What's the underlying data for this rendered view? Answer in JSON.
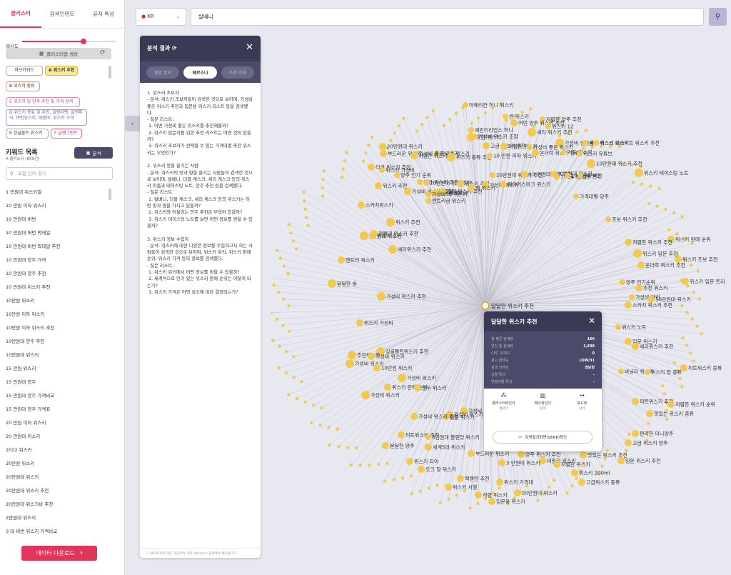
{
  "tabs": [
    "클러스터",
    "검색인텐트",
    "유저 특성"
  ],
  "slider": {
    "label": "해상도",
    "value": 0.65
  },
  "gen_btn": "클러스터맵 생성",
  "chips": [
    "허브키워드",
    "A 위스키 추천",
    "B 위스키 종류",
    "C 위스키 및 양주 추천 및 가격 검색",
    "D 위스키 종류 및 추천, 글렌리벳, 글렌피딕, 버번위스키, 에덴바, 위스키 가격",
    "E 싱글몰트 위스키",
    "F 글렌그란트"
  ],
  "kw": {
    "title": "키워드 목록",
    "sub": "A 클러스터 (659건)",
    "analyze": "분석",
    "placeholder": "포함 단어 찾기",
    "items": [
      "1 만원대 위스키갤",
      "10 만원 이하 위스키",
      "10 만원대 버번",
      "10 만원대 버번 락테일",
      "10 만원대 버번 락테일 추천",
      "10 만원대 양주 가격",
      "10 만원대 양주 추천",
      "10 만원대 위스키 추천",
      "10만원 위스키",
      "10만원 이하 위스키",
      "10만원 이하 위스키 추천",
      "10만원대 양주 추천",
      "10만원대 위스키",
      "15 만원 위스키",
      "15 만원대 양주",
      "15 만원대 양주 가격비교",
      "15 만원대 양주 가격표",
      "20 만원 이하 위스키",
      "20 만원대 위스키",
      "2022 위스키",
      "20만원 위스키",
      "20만원대 위스키",
      "20만원대 위스키 추천",
      "20만원대 위스키바 추천",
      "2만원대 위스키",
      "3 대 버번 위스키 가격비교"
    ]
  },
  "download": "데이터 다운로드",
  "country": "KR",
  "search": "발베니",
  "panel": {
    "title": "분석 결과",
    "tabs": [
      "종합 분석",
      "페르소나",
      "추천 조회"
    ],
    "body": "1. 위스키 초보자\n- 분석: 위스키 초보자들이 검색한 것으로 보이며, 가성비 좋은 위스키 추천과 입문용 위스키 리스트 등을 검색했다.\n- 질문 리스트:\n 1. 어떤 가성비 좋은 위스키를 추천해줄까?\n 2. 위스키 입문자를 위한 추천 리스트는 어떤 것이 있을까?\n 3. 위스키 초보자가 선택할 수 있는 가격대별 추천 위스키는 무엇인가?\n\n2. 위스키 맛을 즐기는 사람\n- 분석: 위스키의 맛과 향을 즐기는 사람들이 검색한 것으로 보이며, 발베니, 더블 캐스크, 셰리 캐스크 등의 위스키 이름과 테이스팅 노트, 안주 추천 등을 검색했다.\n- 질문 리스트:\n 1. 발베니, 더블 캐스크, 셰리 캐스크 등의 위스키는 어떤 맛과 향을 가지고 있을까?\n 2. 위스키와 어울리는 안주 추천은 무엇이 있을까?\n 3. 위스키 테이스팅 노트를 보면 어떤 정보를 얻을 수 있을까?\n\n3. 위스키 정보 수집자\n- 분석: 위스키에 대한 다양한 정보를 수집하고자 하는 사람들이 검색한 것으로 보이며, 위스키 위키, 위스키 판매 순위, 위스키 가격 등의 정보를 검색했다.\n- 질문 리스트:\n 1. 위스키 위키에서 어떤 정보를 얻을 수 있을까?\n 2. 세계적으로 인기 있는 위스키 판매 순위는 어떻게 되는가?\n 3. 위스키 가격은 어떤 요소에 따라 결정되는가?",
    "footer": "ⓘ 66/30자의 해당 가능하며, 이후 Advance 플랜에서 확인합니다."
  },
  "popup": {
    "title": "달달한 위스키 추천",
    "rows": [
      [
        "월 평균 검색량",
        "166"
      ],
      [
        "연간 총 검색량",
        "1,938"
      ],
      [
        "CPC (USD)",
        "0"
      ],
      [
        "광고 경쟁도",
        "LOW/31"
      ],
      [
        "검색 인텐트",
        "정보형"
      ],
      [
        "성별 특성",
        "-"
      ],
      [
        "연령대별 특성",
        "-"
      ]
    ],
    "actions": [
      [
        "클러스터파인더",
        "재탐색"
      ],
      [
        "패스파인더",
        "탐색"
      ],
      [
        "로드뷰",
        "탐색"
      ]
    ],
    "serp": "검색결과화면(SERP)확인"
  },
  "graph": {
    "center": "달달한 위스키 추천",
    "nodes": [
      [
        "아메리칸 허니 위스키",
        652,
        147,
        4
      ],
      [
        "저렴한 양주 추천",
        760,
        167,
        4
      ],
      [
        "어떤 양주 위스키 추천",
        720,
        172,
        5
      ],
      [
        "위스키 12",
        768,
        177,
        4
      ],
      [
        "싼 위스키",
        708,
        163,
        4
      ],
      [
        "예반리리엄스 허니",
        660,
        182,
        4
      ],
      [
        "셰리 위스키 추천",
        745,
        185,
        6
      ],
      [
        "핫한 위스키",
        660,
        192,
        6
      ],
      [
        "가성비 위스키 조합",
        665,
        191,
        4
      ],
      [
        "가성비 싱글몰트",
        784,
        200,
        6
      ],
      [
        "셰리 캐스크 위스키",
        820,
        200,
        4
      ],
      [
        "고급 위스키 추천",
        681,
        204,
        5
      ],
      [
        "저렴한 위스키",
        706,
        205,
        5
      ],
      [
        "가성비 좋은 위스키",
        742,
        206,
        4
      ],
      [
        "위스키 브라이트 위스키 추천",
        835,
        200,
        4
      ],
      [
        "20만원대 위스키",
        536,
        205,
        5
      ],
      [
        "부드러운 위스키",
        537,
        215,
        5
      ],
      [
        "유니콘 위스키",
        612,
        215,
        4
      ],
      [
        "가성비 좋은 위스키",
        582,
        215,
        4
      ],
      [
        "저렴한 위스키",
        580,
        218,
        5
      ],
      [
        "위스키 종류 추천",
        632,
        220,
        6
      ],
      [
        "10 만원 이하 위스키",
        686,
        218,
        4
      ],
      [
        "온더락 위스키 종류",
        750,
        214,
        5
      ],
      [
        "저도 위스키",
        790,
        213,
        4
      ],
      [
        "위스키 유튜브",
        812,
        215,
        4
      ],
      [
        "10만원대 위스키 추천",
        828,
        229,
        6
      ],
      [
        "리카 위스키 추천",
        520,
        234,
        5
      ],
      [
        "위스키 가성비",
        535,
        238,
        4
      ],
      [
        "양주 인기 순위",
        556,
        245,
        4
      ],
      [
        "20만원대 위스키 추천",
        690,
        245,
        4
      ],
      [
        "10 만원대 양주 추천",
        735,
        244,
        5
      ],
      [
        "20만원대 위스키",
        775,
        243,
        4
      ],
      [
        "7~24 캐스크",
        780,
        248,
        4
      ],
      [
        "10만원대 버번",
        795,
        246,
        4
      ],
      [
        "24 빌즈",
        813,
        246,
        4
      ],
      [
        "위스키 테이스팅 노트",
        895,
        242,
        6
      ],
      [
        "저가 위스키 추천",
        588,
        255,
        4
      ],
      [
        "20만원대 양주 추천",
        597,
        256,
        4
      ],
      [
        "위스키 추천",
        645,
        257,
        5
      ],
      [
        "가성비 위스키",
        680,
        259,
        5
      ],
      [
        "위스키 추천",
        530,
        260,
        5
      ],
      [
        "가성비 비 양주 추천",
        571,
        268,
        5
      ],
      [
        "양주 가격표",
        608,
        270,
        4
      ],
      [
        "가성비 위스키",
        610,
        270,
        5
      ],
      [
        "로얄 위스키 추천",
        620,
        268,
        5
      ],
      [
        "가성비 비 위스키",
        600,
        272,
        4
      ],
      [
        "벨 위스키",
        660,
        263,
        5
      ],
      [
        "메이커스마크 위스키",
        705,
        258,
        5
      ],
      [
        "엔트리급 위스키",
        600,
        281,
        4
      ],
      [
        "가격대별 양주",
        807,
        275,
        4
      ],
      [
        "스카치위스키",
        506,
        287,
        5
      ],
      [
        "위스키 추천",
        547,
        311,
        6
      ],
      [
        "초보 위스키 추천",
        852,
        307,
        4
      ],
      [
        "2만원대 위스키",
        510,
        330,
        6
      ],
      [
        "위스키 추천",
        522,
        330,
        5
      ],
      [
        "정몰대 위스키 추천",
        524,
        327,
        5
      ],
      [
        "위스키 판매 순위",
        940,
        335,
        5
      ],
      [
        "저렴한 위스키 추천",
        880,
        339,
        5
      ],
      [
        "셰리위스키 추천",
        550,
        349,
        6
      ],
      [
        "위스키 입문 추천",
        893,
        355,
        6
      ],
      [
        "위스키 초보 추천",
        950,
        363,
        5
      ],
      [
        "엔트리 위스키",
        478,
        364,
        5
      ],
      [
        "온더락 위스키 추천",
        898,
        371,
        5
      ],
      [
        "양주 인기순위",
        872,
        395,
        4
      ],
      [
        "위스키 입문 트리",
        960,
        394,
        5
      ],
      [
        "달달한 술",
        465,
        397,
        6
      ],
      [
        "추천 위스키",
        895,
        403,
        5
      ],
      [
        "가성비 위스키 추천",
        534,
        415,
        6
      ],
      [
        "가성비 버번",
        885,
        416,
        4
      ],
      [
        "10만원대 위스키",
        912,
        419,
        5
      ],
      [
        "스카치 위스키 추천",
        880,
        427,
        5
      ],
      [
        "위스키 가성비",
        504,
        452,
        5
      ],
      [
        "위스키 노트",
        866,
        458,
        4
      ],
      [
        "싱글몰트위스키 추천",
        533,
        492,
        6
      ],
      [
        "입문 위스키",
        880,
        478,
        5
      ],
      [
        "추천위스키",
        493,
        497,
        6
      ],
      [
        "셰리위스키 추천",
        890,
        485,
        5
      ],
      [
        "가성비 위스키",
        520,
        499,
        5
      ],
      [
        "가성비 위스키",
        490,
        509,
        6
      ],
      [
        "10만원 위스키",
        528,
        515,
        5
      ],
      [
        "피트위스키 종류",
        958,
        515,
        5
      ],
      [
        "가성비 위스키",
        563,
        529,
        6
      ],
      [
        "바닐라 위스키",
        870,
        520,
        4
      ],
      [
        "위스키 향 종류",
        907,
        521,
        4
      ],
      [
        "위스키 판매 순위",
        543,
        542,
        5
      ],
      [
        "담두 위스키",
        585,
        543,
        5
      ],
      [
        "가성비 위스키",
        512,
        553,
        6
      ],
      [
        "피트위스키 추천",
        890,
        562,
        5
      ],
      [
        "저렴한 위스키 순위",
        940,
        566,
        5
      ],
      [
        "맛있는 위스키 종류",
        910,
        579,
        5
      ],
      [
        "가성비 위스키 순위",
        650,
        575,
        5
      ],
      [
        "가성비 위스키",
        630,
        580,
        5
      ],
      [
        "입문 위스키",
        625,
        584,
        4
      ],
      [
        "가성비 위스키 추천",
        580,
        583,
        5
      ],
      [
        "편리한 미니양주",
        890,
        607,
        5
      ],
      [
        "피트위스키 추천",
        562,
        609,
        5
      ],
      [
        "고급 위스키 양주",
        880,
        620,
        5
      ],
      [
        "3만원대 불렌딩 위스키",
        600,
        612,
        4
      ],
      [
        "세계5대 위스키",
        600,
        626,
        5
      ],
      [
        "달달한 양주",
        540,
        624,
        5
      ],
      [
        "위스키 티어",
        574,
        646,
        5
      ],
      [
        "부드러운 위스키",
        660,
        635,
        5
      ],
      [
        "양주 위스키 추천",
        730,
        636,
        5
      ],
      [
        "맛있는 위스키 추천",
        817,
        637,
        5
      ],
      [
        "오크 향 위스키",
        590,
        657,
        5
      ],
      [
        "데일리 위스키",
        760,
        645,
        5
      ],
      [
        "저렴한 위스키",
        780,
        650,
        5
      ],
      [
        "입문 위스키 추천",
        870,
        645,
        5
      ],
      [
        "3 만원대 위스키",
        703,
        648,
        5
      ],
      [
        "위스키 200ml",
        805,
        662,
        5
      ],
      [
        "맥캘란 추천",
        645,
        670,
        5
      ],
      [
        "위스키 가격대",
        700,
        675,
        5
      ],
      [
        "고급위스키 종류",
        815,
        675,
        5
      ],
      [
        "위스키 서열",
        628,
        682,
        5
      ],
      [
        "20만원대 위스키",
        725,
        690,
        5
      ],
      [
        "저렴 위스키",
        670,
        693,
        5
      ],
      [
        "입문용 위스키",
        689,
        702,
        5
      ]
    ]
  }
}
